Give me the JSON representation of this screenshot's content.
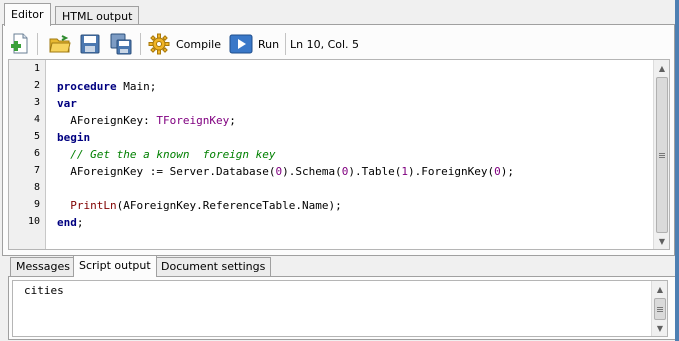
{
  "top_tabs": [
    {
      "label": "Editor",
      "active": true
    },
    {
      "label": "HTML output",
      "active": false
    }
  ],
  "toolbar": {
    "new_icon": "new-document-icon",
    "open_icon": "open-folder-icon",
    "save_icon": "save-icon",
    "save_all_icon": "save-all-icon",
    "compile_label": "Compile",
    "compile_icon": "gear-icon",
    "run_label": "Run",
    "run_icon": "play-icon",
    "position": "Ln 10, Col. 5"
  },
  "editor": {
    "line_numbers": [
      "1",
      "2",
      "3",
      "4",
      "5",
      "6",
      "7",
      "8",
      "9",
      "10"
    ],
    "lines": [
      [],
      [
        {
          "t": "procedure",
          "c": "kw"
        },
        {
          "t": " Main;",
          "c": ""
        }
      ],
      [
        {
          "t": "var",
          "c": "kw"
        }
      ],
      [
        {
          "t": "  AForeignKey: ",
          "c": ""
        },
        {
          "t": "TForeignKey",
          "c": "typ"
        },
        {
          "t": ";",
          "c": ""
        }
      ],
      [
        {
          "t": "begin",
          "c": "kw"
        }
      ],
      [
        {
          "t": "  // Get the a known  foreign key",
          "c": "cm"
        }
      ],
      [
        {
          "t": "  AForeignKey := Server.Database(",
          "c": ""
        },
        {
          "t": "0",
          "c": "num"
        },
        {
          "t": ").Schema(",
          "c": ""
        },
        {
          "t": "0",
          "c": "num"
        },
        {
          "t": ").Table(",
          "c": ""
        },
        {
          "t": "1",
          "c": "num"
        },
        {
          "t": ").ForeignKey(",
          "c": ""
        },
        {
          "t": "0",
          "c": "num"
        },
        {
          "t": ");",
          "c": ""
        }
      ],
      [],
      [
        {
          "t": "  ",
          "c": ""
        },
        {
          "t": "PrintLn",
          "c": "fn"
        },
        {
          "t": "(AForeignKey.ReferenceTable.Name);",
          "c": ""
        }
      ],
      [
        {
          "t": "end",
          "c": "kw"
        },
        {
          "t": ";",
          "c": ""
        }
      ]
    ]
  },
  "bottom_tabs": [
    {
      "label": "Messages",
      "active": false
    },
    {
      "label": "Script output",
      "active": true
    },
    {
      "label": "Document settings",
      "active": false
    }
  ],
  "output": {
    "text": "cities"
  },
  "colors": {
    "keyword": "#000080",
    "comment": "#008000",
    "number": "#800080",
    "function": "#800000",
    "window_edge": "#4d7fb2"
  }
}
